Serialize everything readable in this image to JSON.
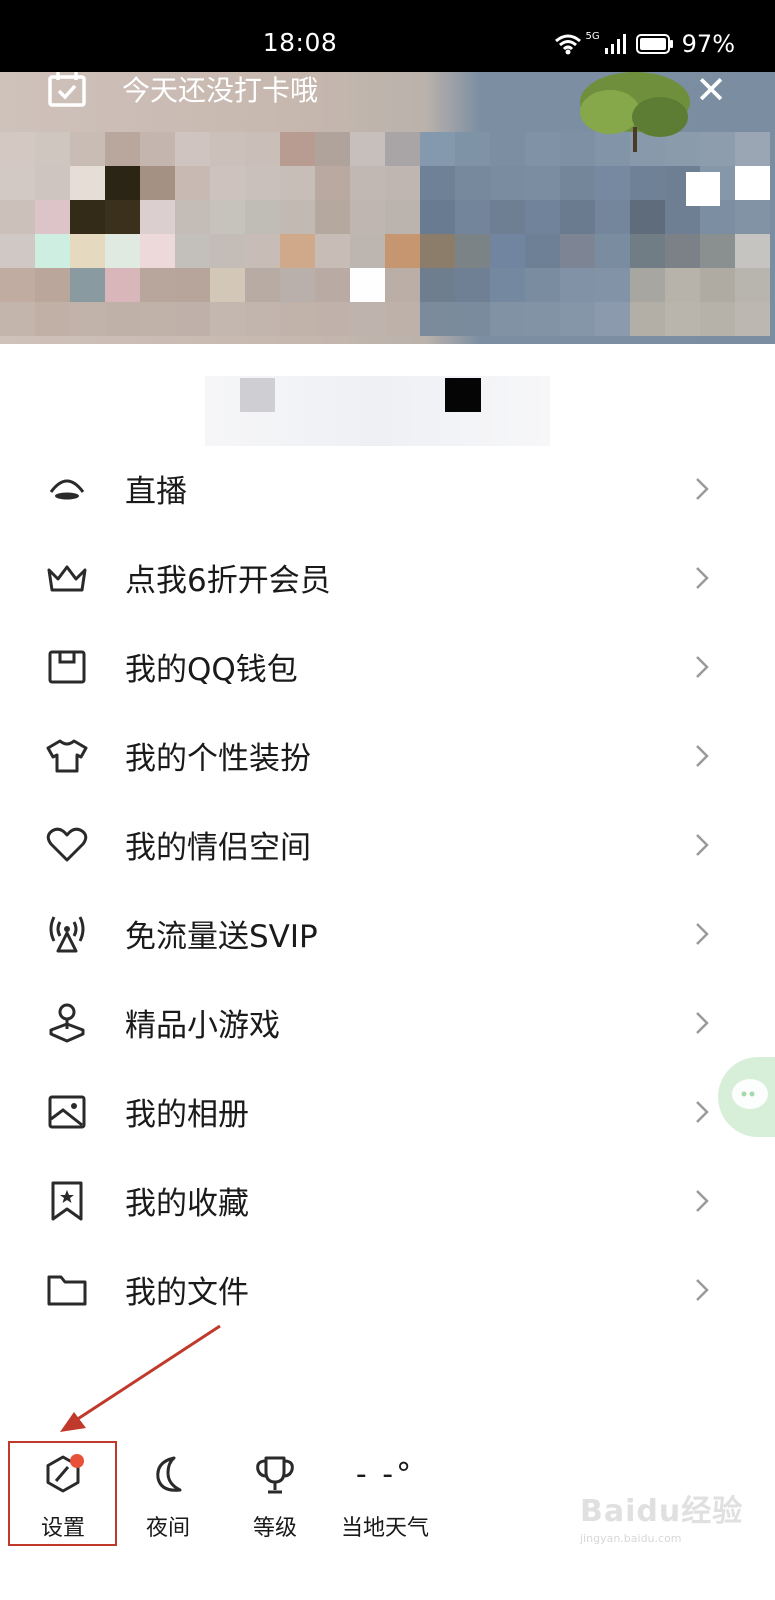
{
  "status_bar": {
    "time": "18:08",
    "network": "5G",
    "battery": "97%"
  },
  "header": {
    "checkin_text": "今天还没打卡哦",
    "close_symbol": "✕"
  },
  "menu": [
    {
      "label": "直播",
      "icon": "live-icon"
    },
    {
      "label": "点我6折开会员",
      "icon": "crown-icon"
    },
    {
      "label": "我的QQ钱包",
      "icon": "wallet-icon"
    },
    {
      "label": "我的个性装扮",
      "icon": "shirt-icon"
    },
    {
      "label": "我的情侣空间",
      "icon": "heart-icon"
    },
    {
      "label": "免流量送SVIP",
      "icon": "signal-tower-icon"
    },
    {
      "label": "精品小游戏",
      "icon": "joystick-icon"
    },
    {
      "label": "我的相册",
      "icon": "photo-album-icon"
    },
    {
      "label": "我的收藏",
      "icon": "bookmark-star-icon"
    },
    {
      "label": "我的文件",
      "icon": "folder-icon"
    }
  ],
  "toolbar": [
    {
      "label": "设置",
      "icon": "settings-hexagon-icon",
      "badge": true
    },
    {
      "label": "夜间",
      "icon": "moon-icon"
    },
    {
      "label": "等级",
      "icon": "trophy-icon"
    },
    {
      "label": "当地天气",
      "icon_text": "- -°"
    }
  ],
  "watermark": {
    "brand": "Baidu经验",
    "url": "jingyan.baidu.com"
  },
  "colors": {
    "highlight": "#c0392b",
    "badge": "#e8503a",
    "text": "#1a1a1a",
    "chevron": "#9a9a9a"
  }
}
